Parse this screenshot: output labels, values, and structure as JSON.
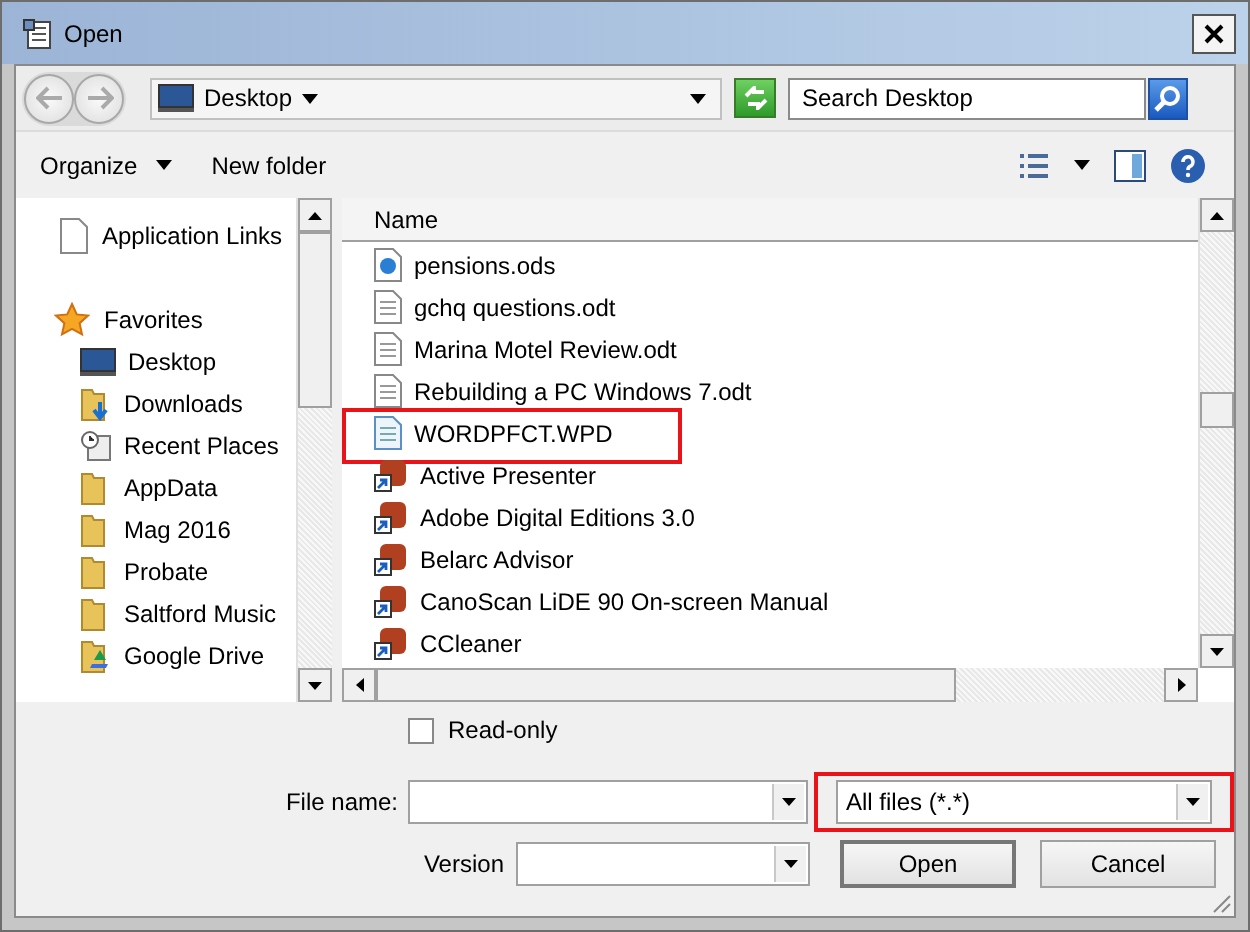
{
  "window": {
    "title": "Open"
  },
  "address": {
    "location": "Desktop"
  },
  "search": {
    "placeholder": "Search Desktop"
  },
  "toolbar": {
    "organize": "Organize",
    "new_folder": "New folder"
  },
  "navigation": [
    {
      "label": "Application Links",
      "kind": "page"
    },
    {
      "label": "Favorites",
      "kind": "star",
      "children": [
        {
          "label": "Desktop",
          "kind": "desktop"
        },
        {
          "label": "Downloads",
          "kind": "downloads"
        },
        {
          "label": "Recent Places",
          "kind": "recent"
        },
        {
          "label": "AppData",
          "kind": "folder"
        },
        {
          "label": "Mag 2016",
          "kind": "folder"
        },
        {
          "label": "Probate",
          "kind": "folder"
        },
        {
          "label": "Saltford Music",
          "kind": "folder"
        },
        {
          "label": "Google Drive",
          "kind": "drive"
        }
      ]
    }
  ],
  "file_list": {
    "column": "Name",
    "files": [
      {
        "name": "pensions.ods",
        "kind": "spreadsheet",
        "highlighted": false
      },
      {
        "name": "gchq questions.odt",
        "kind": "document",
        "highlighted": false
      },
      {
        "name": "Marina Motel Review.odt",
        "kind": "document",
        "highlighted": false
      },
      {
        "name": "Rebuilding a PC Windows 7.odt",
        "kind": "document",
        "highlighted": false
      },
      {
        "name": "WORDPFCT.WPD",
        "kind": "wordperfect",
        "highlighted": true
      },
      {
        "name": "Active Presenter",
        "kind": "shortcut",
        "highlighted": false
      },
      {
        "name": "Adobe Digital Editions 3.0",
        "kind": "shortcut",
        "highlighted": false
      },
      {
        "name": "Belarc Advisor",
        "kind": "shortcut",
        "highlighted": false
      },
      {
        "name": "CanoScan LiDE 90 On-screen Manual",
        "kind": "shortcut",
        "highlighted": false
      },
      {
        "name": "CCleaner",
        "kind": "shortcut",
        "highlighted": false
      }
    ]
  },
  "read_only": {
    "label": "Read-only",
    "checked": false
  },
  "file_name": {
    "label": "File name:"
  },
  "file_type": {
    "value": "All files (*.*)",
    "highlighted": true
  },
  "version": {
    "label": "Version"
  },
  "buttons": [
    {
      "label": "Open",
      "kind": "default"
    },
    {
      "label": "Cancel",
      "kind": "normal"
    }
  ]
}
